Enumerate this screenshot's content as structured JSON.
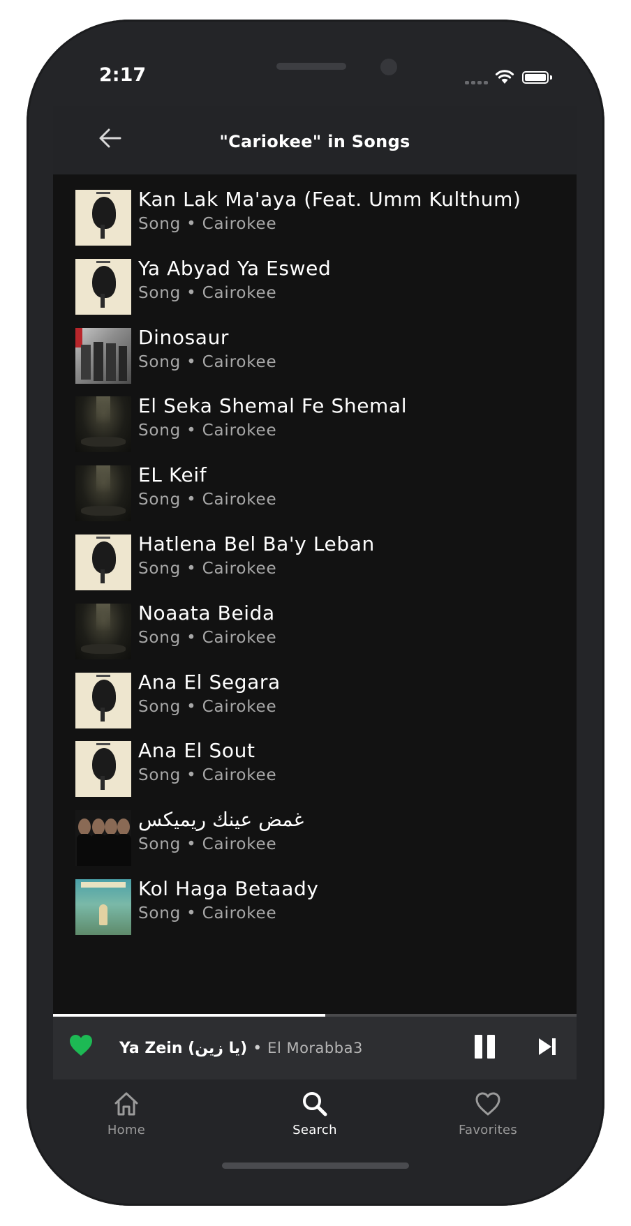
{
  "status_bar": {
    "time": "2:17"
  },
  "header": {
    "title": "\"Cariokee\" in Songs",
    "back_icon": "arrow-left-icon"
  },
  "songs": [
    {
      "title": "Kan Lak Ma'aya (Feat. Umm Kulthum)",
      "subtitle": "Song • Cairokee",
      "art": "cream"
    },
    {
      "title": "Ya Abyad Ya Eswed",
      "subtitle": "Song • Cairokee",
      "art": "cream"
    },
    {
      "title": "Dinosaur",
      "subtitle": "Song • Cairokee",
      "art": "photo"
    },
    {
      "title": "El Seka Shemal Fe Shemal",
      "subtitle": "Song • Cairokee",
      "art": "dark"
    },
    {
      "title": "EL Keif",
      "subtitle": "Song • Cairokee",
      "art": "dark"
    },
    {
      "title": "Hatlena Bel Ba'y Leban",
      "subtitle": "Song • Cairokee",
      "art": "cream"
    },
    {
      "title": "Noaata Beida",
      "subtitle": "Song • Cairokee",
      "art": "dark"
    },
    {
      "title": "Ana El Segara",
      "subtitle": "Song • Cairokee",
      "art": "cream"
    },
    {
      "title": "Ana El Sout",
      "subtitle": "Song • Cairokee",
      "art": "cream"
    },
    {
      "title": "غمض عينك ريميكس",
      "subtitle": "Song • Cairokee",
      "art": "band"
    },
    {
      "title": "Kol Haga Betaady",
      "subtitle": "Song • Cairokee",
      "art": "poster"
    }
  ],
  "now_playing": {
    "title": "Ya Zein (يا زين)",
    "separator": "•",
    "artist": "El Morabba3",
    "progress": 0.52,
    "liked": true,
    "heart_color": "#1db954"
  },
  "tabs": [
    {
      "label": "Home",
      "icon": "home-icon",
      "active": false
    },
    {
      "label": "Search",
      "icon": "search-icon",
      "active": true
    },
    {
      "label": "Favorites",
      "icon": "heart-outline-icon",
      "active": false
    }
  ]
}
